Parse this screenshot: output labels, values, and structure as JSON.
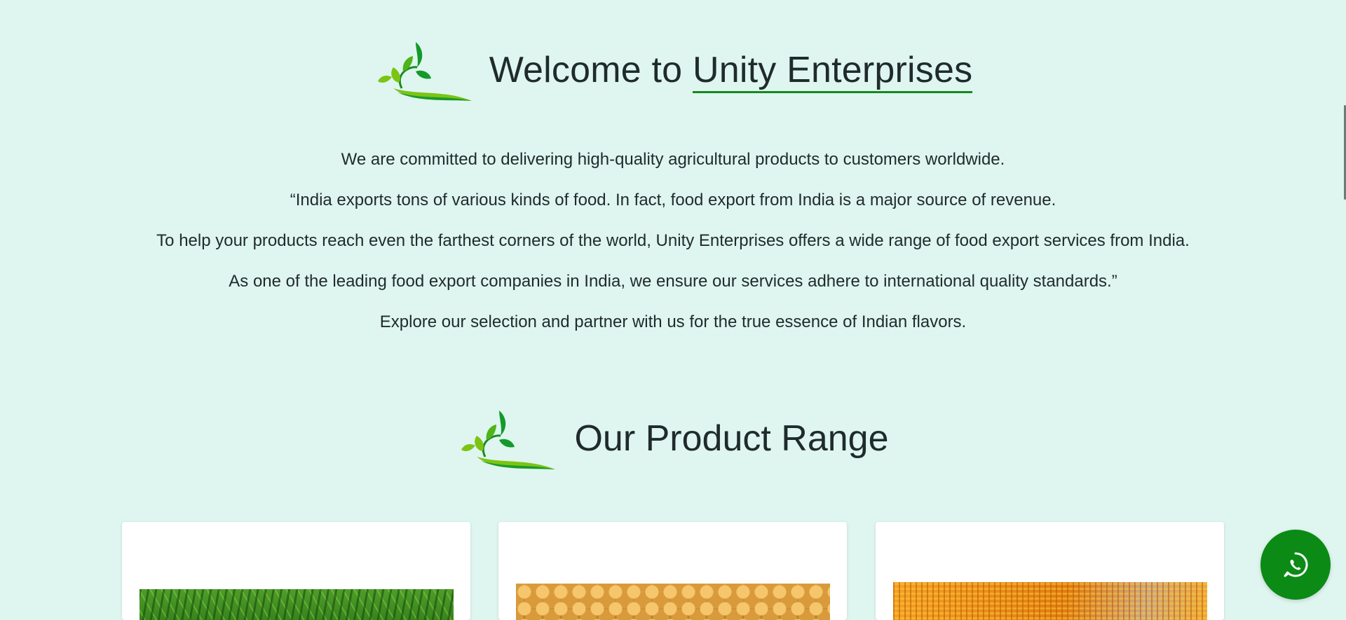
{
  "welcome": {
    "title_prefix": "Welcome to ",
    "title_brand": "Unity Enterprises"
  },
  "intro": {
    "paragraphs": [
      "We are committed to delivering high-quality agricultural products to customers worldwide.",
      "“India exports tons of various kinds of food. In fact, food export from India is a major source of revenue.",
      "To help your products reach even the farthest corners of the world, Unity Enterprises offers a wide range of food export services from India.",
      "As one of the leading food export companies in India, we ensure our services adhere to international quality standards.”",
      "Explore our selection and partner with us for the true essence of Indian flavors."
    ]
  },
  "products": {
    "title": "Our Product Range",
    "cards": [
      {
        "image": "green-chillies-image"
      },
      {
        "image": "mangoes-image"
      },
      {
        "image": "corn-cobs-image"
      }
    ]
  },
  "floating": {
    "whatsapp_icon": "whatsapp-icon"
  },
  "colors": {
    "background": "#dff5ef",
    "accent_green": "#118a1e",
    "whatsapp_green": "#0b8a16",
    "text": "#1f2b2b"
  }
}
